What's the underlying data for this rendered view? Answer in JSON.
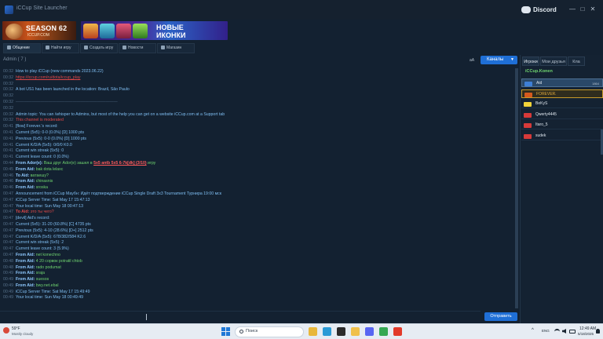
{
  "window": {
    "title": "iCCup Site Launcher",
    "discord_label": "Discord",
    "controls": [
      "—",
      "□",
      "✕"
    ]
  },
  "banners": [
    {
      "line1": "SEASON 62",
      "line2": "ICCUP.COM"
    },
    {
      "line1": "НОВЫЕ",
      "line2": "ИКОНКИ"
    }
  ],
  "tabs": [
    {
      "label": "Общение",
      "icon": "chat-icon",
      "active": true
    },
    {
      "label": "Найти игру",
      "icon": "crossed-swords-icon",
      "active": false
    },
    {
      "label": "Создать игру",
      "icon": "plus-icon",
      "active": false
    },
    {
      "label": "Новости",
      "icon": "news-icon",
      "active": false
    },
    {
      "label": "Магазин",
      "icon": "cart-icon",
      "active": false
    }
  ],
  "chat": {
    "room_label": "Admin ( 7 )",
    "font_toggle": "aA",
    "channels_button": "Каналы",
    "messages": [
      {
        "time": "00:32",
        "style": "blue",
        "text": "How to play iCCup (new commands 2023.06.22)"
      },
      {
        "time": "00:32",
        "style": "link",
        "text": "https://iccup.com/ru/dota/iccup_play"
      },
      {
        "time": "00:32",
        "style": "blue",
        "text": ""
      },
      {
        "time": "00:32",
        "style": "blue",
        "text": "A bot US1 has been launched in the location:  Brazil, São Paulo"
      },
      {
        "time": "00:32",
        "style": "blue",
        "text": ""
      },
      {
        "time": "00:32",
        "style": "rule",
        "text": "—————————————————————————"
      },
      {
        "time": "00:32",
        "style": "blue",
        "text": ""
      },
      {
        "time": "00:32",
        "style": "blue",
        "text": "Admin topic: You can /whisper to Admins, but most of the help you can get on a website iCCup.com at a Support tab"
      },
      {
        "time": "00:32",
        "style": "red",
        "text": "This channel is moderated"
      },
      {
        "time": "00:41",
        "style": "blue",
        "text": "[flow] Forever.'s record:"
      },
      {
        "time": "00:41",
        "style": "blue",
        "text": "Current (5x5): 0-0 (0.0%) [D] 1000 pts"
      },
      {
        "time": "00:41",
        "style": "blue",
        "text": "Previous (5x5): 0-0 (0.0%) [D] 1000 pts"
      },
      {
        "time": "00:41",
        "style": "blue",
        "text": "Current K/D/A (5x5): 0/0/0 K0.0"
      },
      {
        "time": "00:41",
        "style": "blue",
        "text": "Current win streak (5x5): 0"
      },
      {
        "time": "00:41",
        "style": "blue",
        "text": "Current leave count: 0 (0.0%)"
      },
      {
        "time": "00:44",
        "style": "invite",
        "sender": "From Ador(e):",
        "text": "Ваш друг Ador(e) зашел в",
        "highlight": "5x5 antb 5x5 6-7k[dk] (3/10)",
        "suffix": "игру"
      },
      {
        "time": "00:45",
        "style": "from",
        "sender": "From Aid:",
        "text": "bak dota lelaxc"
      },
      {
        "time": "00:46",
        "style": "to",
        "sender": "To Aid:",
        "text": "ватаешу?"
      },
      {
        "time": "00:46",
        "style": "from",
        "sender": "From Aid:",
        "text": "chinasnis"
      },
      {
        "time": "00:46",
        "style": "from",
        "sender": "From Aid:",
        "text": "sroska"
      },
      {
        "time": "00:47",
        "style": "blue",
        "text": "Announcement from iCCup Маубн: Идёт подтверждение iCCup Single Draft 3x3 Tournament Турнира 19:00 мск"
      },
      {
        "time": "00:47",
        "style": "blue",
        "text": "iCCup Server Time: Sat May 17 15:47:13"
      },
      {
        "time": "00:47",
        "style": "blue",
        "text": "Your local time: Sun May 18 00:47:13"
      },
      {
        "time": "00:47",
        "style": "to-red",
        "sender": "To Aid:",
        "text": "это ты чего?"
      },
      {
        "time": "00:47",
        "style": "blue",
        "text": "[devil] Aid's record:"
      },
      {
        "time": "00:47",
        "style": "blue",
        "text": "Current (5x5): 31-20 (60.8%) [C] 4735 pts"
      },
      {
        "time": "00:47",
        "style": "blue",
        "text": "Previous (5x5): 4-10 (28.6%) [D+] 2512 pts"
      },
      {
        "time": "00:47",
        "style": "blue",
        "text": "Current K/D/A (5x5): 678/382/584 K2.6"
      },
      {
        "time": "00:47",
        "style": "blue",
        "text": "Current win streak (5x5): 2"
      },
      {
        "time": "00:47",
        "style": "blue",
        "text": "Current leave count: 3 (5.9%)"
      },
      {
        "time": "00:47",
        "style": "from",
        "sender": "From Aid:",
        "text": "net konechno"
      },
      {
        "time": "00:48",
        "style": "from",
        "sender": "From Aid:",
        "text": "4 20 сорвок potratil chtob"
      },
      {
        "time": "00:48",
        "style": "from",
        "sender": "From Aid:",
        "text": "rado podumat"
      },
      {
        "time": "00:49",
        "style": "from",
        "sender": "From Aid:",
        "text": "sraja"
      },
      {
        "time": "00:49",
        "style": "from",
        "sender": "From Aid:",
        "text": "suesos"
      },
      {
        "time": "00:49",
        "style": "from",
        "sender": "From Aid:",
        "text": "bwy.net.ebal"
      },
      {
        "time": "00:49",
        "style": "blue",
        "text": "iCCup Server Time: Sat May 17 15:49:49"
      },
      {
        "time": "00:49",
        "style": "blue",
        "text": "Your local time: Sun May 18 00:49:49"
      }
    ],
    "send_button": "Отправить"
  },
  "right_panel": {
    "tabs": [
      "Игроки",
      "Мои друзья",
      "Кла"
    ],
    "channel_name": "iCCup.Konen",
    "users": [
      {
        "name": "Aid",
        "badge": "1864",
        "flag_color": "#3e7fd6",
        "selection": "blue"
      },
      {
        "name": "FOREVER.",
        "badge": "",
        "flag_color": "#d65a1e",
        "selection": "gold"
      },
      {
        "name": "BeKyS",
        "badge": "",
        "flag_color": "#f2d33a",
        "selection": "none"
      },
      {
        "name": "Qwerty4445",
        "badge": "",
        "flag_color": "#d63a3a",
        "selection": "none"
      },
      {
        "name": "Itaro_5",
        "badge": "",
        "flag_color": "#d63a3a",
        "selection": "none"
      },
      {
        "name": "sudek",
        "badge": "",
        "flag_color": "#d63a3a",
        "selection": "none"
      }
    ]
  },
  "taskbar": {
    "weather_temp": "59°F",
    "weather_desc": "Mostly cloudy",
    "search_placeholder": "Поиск",
    "language": "ENG",
    "time": "12:49 AM",
    "date": "5/18/2025",
    "apps": [
      {
        "name": "file-explorer-icon",
        "color": "#e8b73a"
      },
      {
        "name": "edge-icon",
        "color": "#2a9ad6"
      },
      {
        "name": "terminal-icon",
        "color": "#2b2b2b"
      },
      {
        "name": "folder-icon",
        "color": "#f0c04a"
      },
      {
        "name": "discord-icon",
        "color": "#5865f2"
      },
      {
        "name": "chrome-icon",
        "color": "#34a853"
      },
      {
        "name": "yandex-icon",
        "color": "#e23a2a"
      }
    ]
  }
}
